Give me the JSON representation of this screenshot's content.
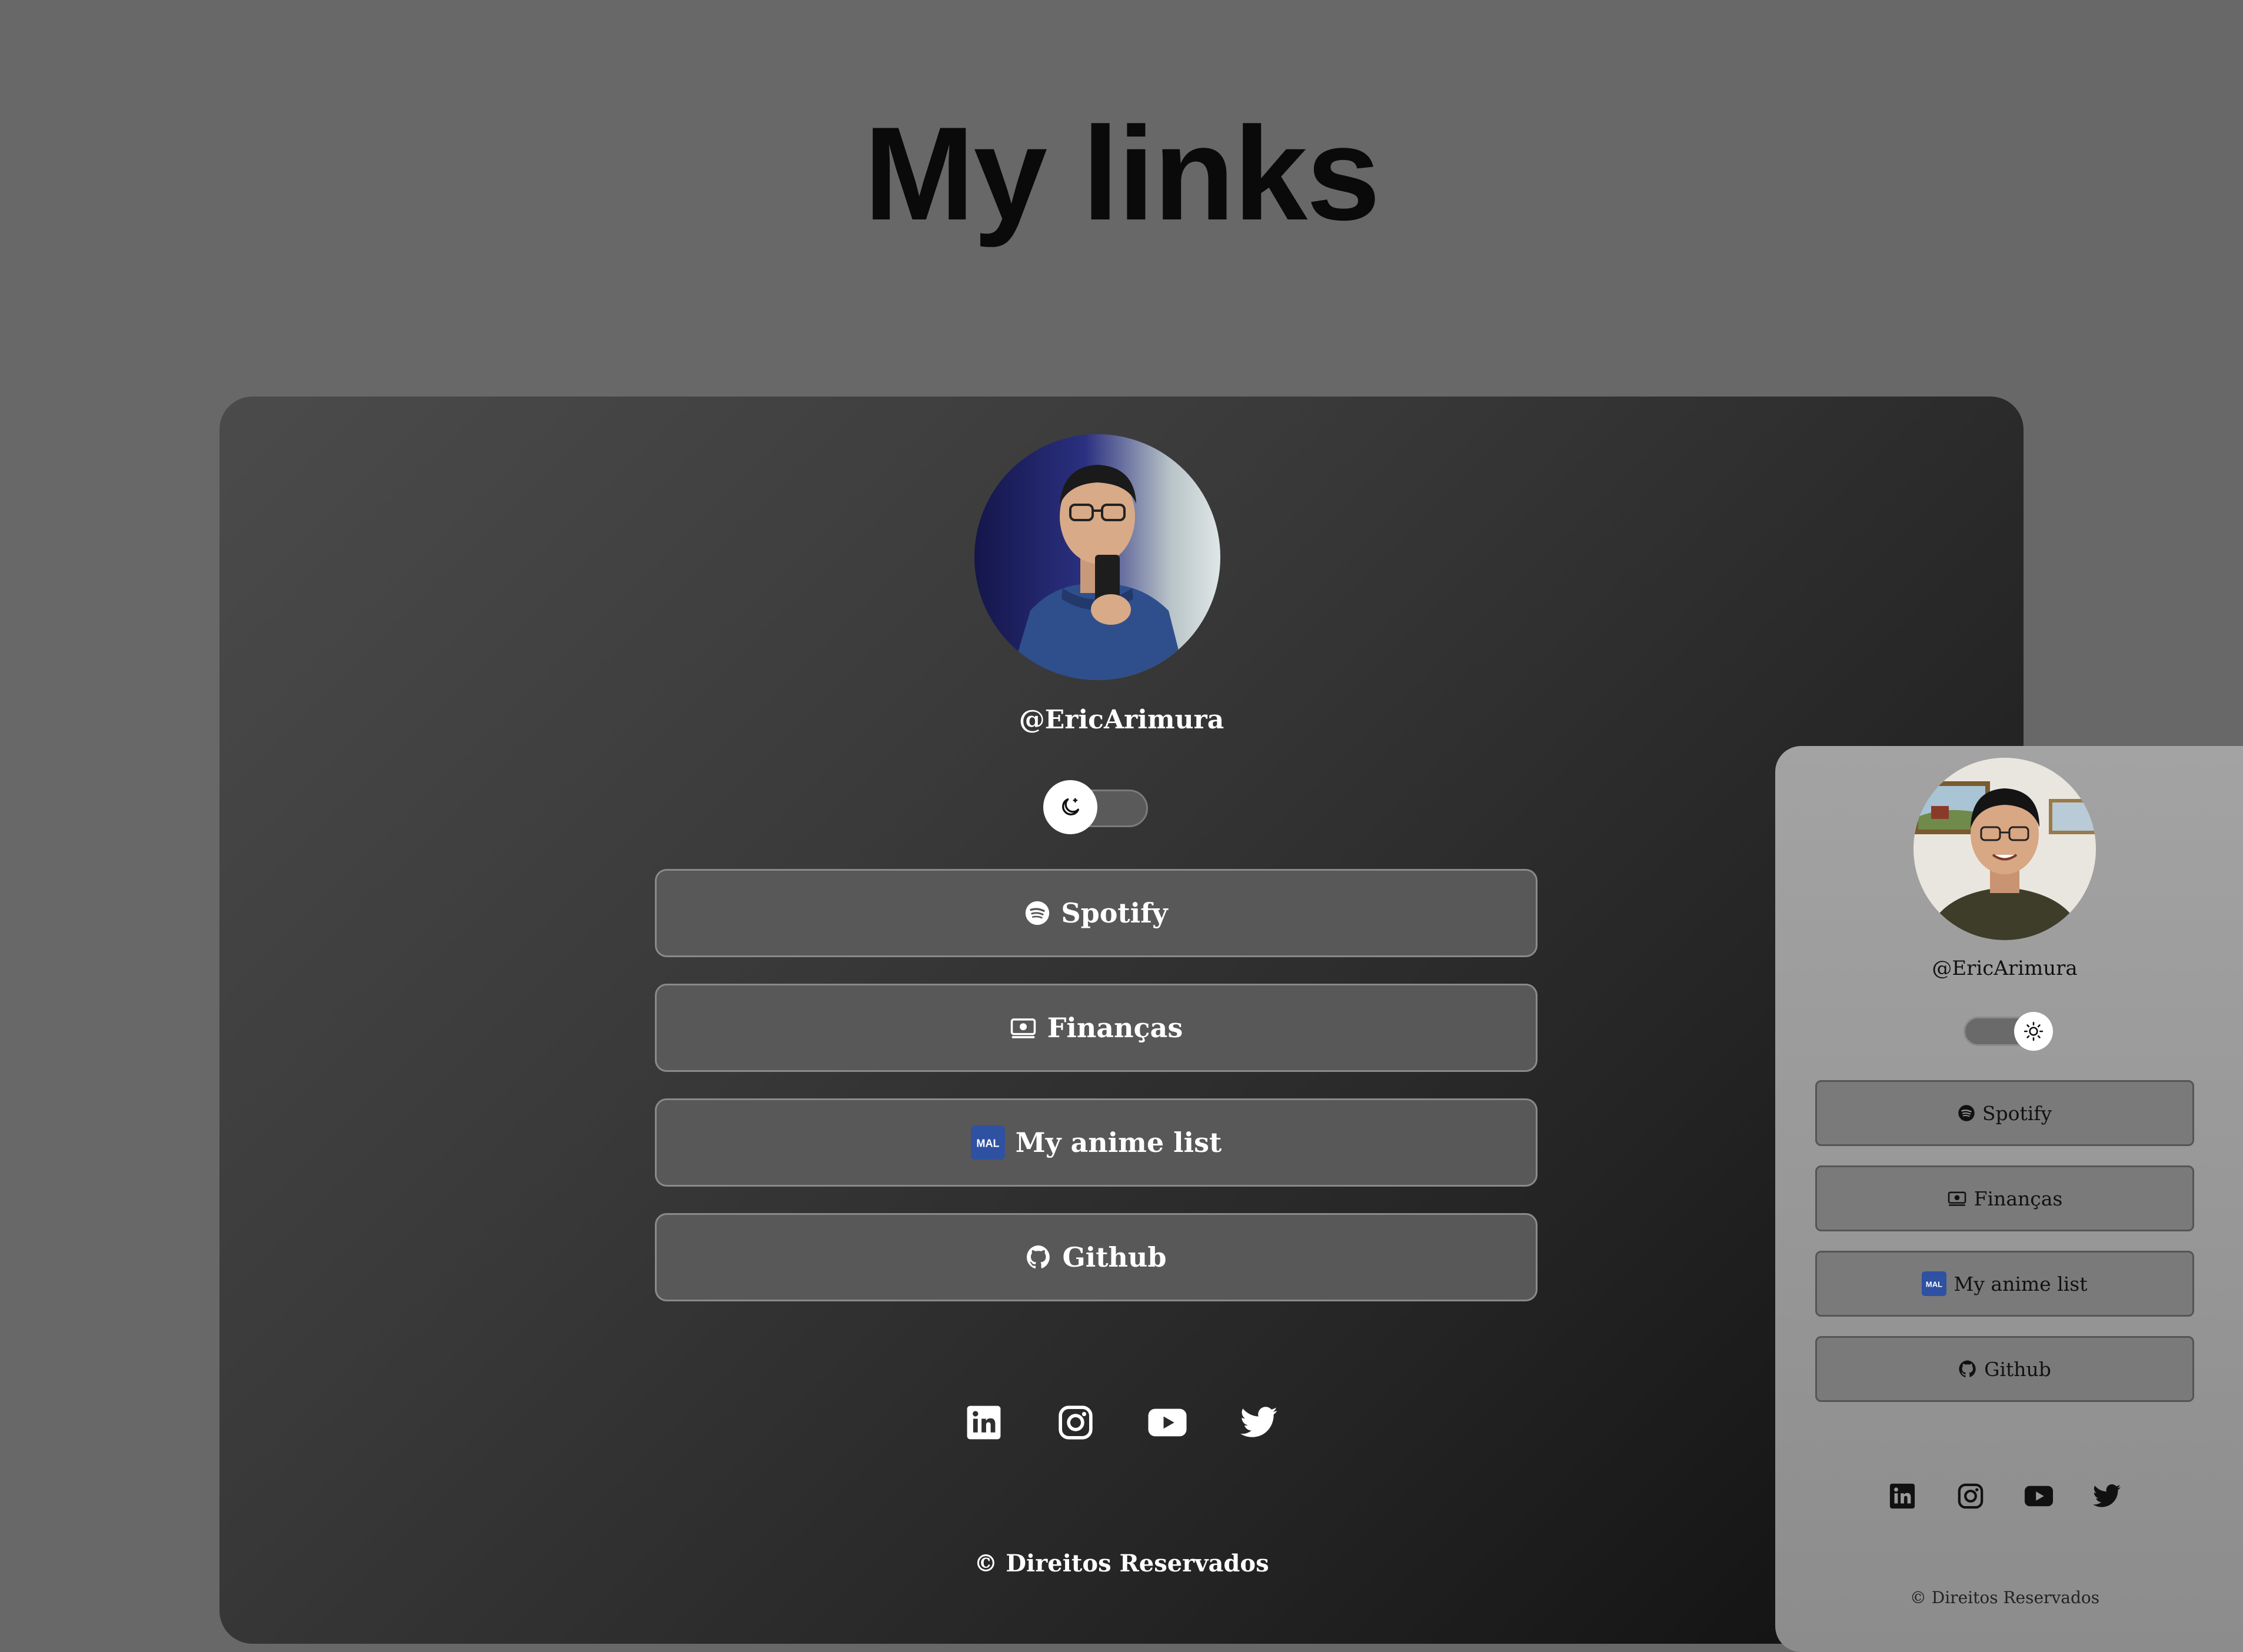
{
  "page": {
    "title": "My links"
  },
  "dark_profile": {
    "username": "@EricArimura",
    "theme": "dark",
    "toggle_icon": "moon-icon",
    "links": [
      {
        "label": "Spotify",
        "icon": "spotify-icon"
      },
      {
        "label": "Finanças",
        "icon": "money-icon"
      },
      {
        "label": "My anime list",
        "icon": "myanimelist-icon",
        "icon_text": "MAL"
      },
      {
        "label": "Github",
        "icon": "github-icon"
      }
    ],
    "socials": [
      "linkedin-icon",
      "instagram-icon",
      "youtube-icon",
      "twitter-icon"
    ],
    "copyright": "© Direitos Reservados"
  },
  "light_profile": {
    "username": "@EricArimura",
    "theme": "light",
    "toggle_icon": "sun-icon",
    "links": [
      {
        "label": "Spotify",
        "icon": "spotify-icon"
      },
      {
        "label": "Finanças",
        "icon": "money-icon"
      },
      {
        "label": "My anime list",
        "icon": "myanimelist-icon",
        "icon_text": "MAL"
      },
      {
        "label": "Github",
        "icon": "github-icon"
      }
    ],
    "socials": [
      "linkedin-icon",
      "instagram-icon",
      "youtube-icon",
      "twitter-icon"
    ],
    "copyright": "© Direitos Reservados"
  },
  "colors": {
    "background": "#686868",
    "title": "#0a0a0a",
    "dark_card_start": "#4b4b4b",
    "dark_card_end": "#0f0f0f",
    "light_card": "#9a9a9a",
    "mal_badge": "#2e51a2"
  }
}
